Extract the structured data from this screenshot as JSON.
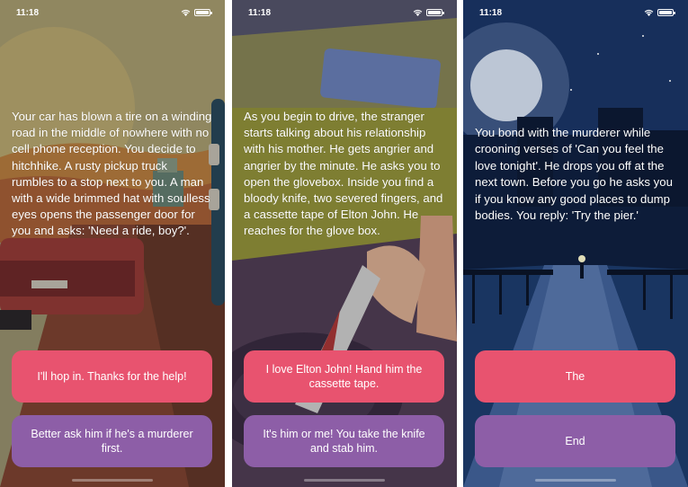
{
  "screens": [
    {
      "status": {
        "time": "11:18"
      },
      "story": "Your car has blown a tire on a winding road in the middle of nowhere with no cell phone reception. You decide to hitchhike. A rusty pickup truck rumbles to a stop next to you. A man with a wide brimmed hat with soulless eyes opens the passenger door for you and asks: 'Need a ride, boy?'.",
      "choice1": "I'll hop in. Thanks for the help!",
      "choice2": "Better ask him if he's a murderer first."
    },
    {
      "status": {
        "time": "11:18"
      },
      "story": "As you begin to drive, the stranger starts talking about his relationship with his mother. He gets angrier and angrier by the minute. He asks you to open the glovebox. Inside you find a bloody knife, two severed fingers, and a cassette tape of Elton John. He reaches for the glove box.",
      "choice1": "I love Elton John! Hand him the cassette tape.",
      "choice2": "It's him or me! You take the knife and stab him."
    },
    {
      "status": {
        "time": "11:18"
      },
      "story": "You bond with the murderer while crooning verses of 'Can you feel the love tonight'. He drops you off at the next town. Before you go he asks you if you know any good places to dump bodies. You reply: 'Try the pier.'",
      "choice1": "The",
      "choice2": "End"
    }
  ],
  "theme": {
    "choice1_color": "#e8536f",
    "choice2_color": "#8d5ea7",
    "text_color": "#ffffff"
  },
  "icons": [
    "wifi-icon",
    "battery-icon"
  ]
}
